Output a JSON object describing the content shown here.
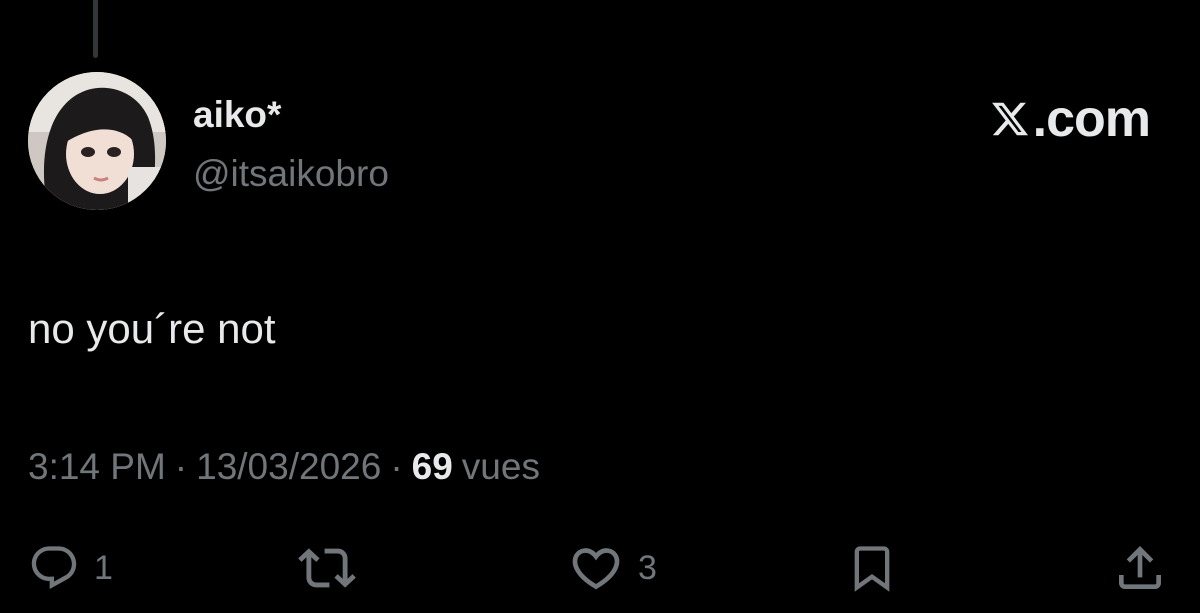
{
  "brand": {
    "logo_glyph": "𝕏",
    "domain": ".com"
  },
  "author": {
    "display_name": "aiko*",
    "handle": "@itsaikobro"
  },
  "tweet": {
    "text": "no you´re not",
    "time": "3:14 PM",
    "separator": "·",
    "date": "13/03/2026",
    "views_count": "69",
    "views_label": "vues"
  },
  "actions": {
    "replies": "1",
    "likes": "3"
  },
  "colors": {
    "background": "#000000",
    "primary_text": "#e7e9ea",
    "secondary_text": "#71767b"
  },
  "icons": [
    "reply-icon",
    "repost-icon",
    "like-icon",
    "bookmark-icon",
    "share-icon",
    "x-logo-icon"
  ]
}
